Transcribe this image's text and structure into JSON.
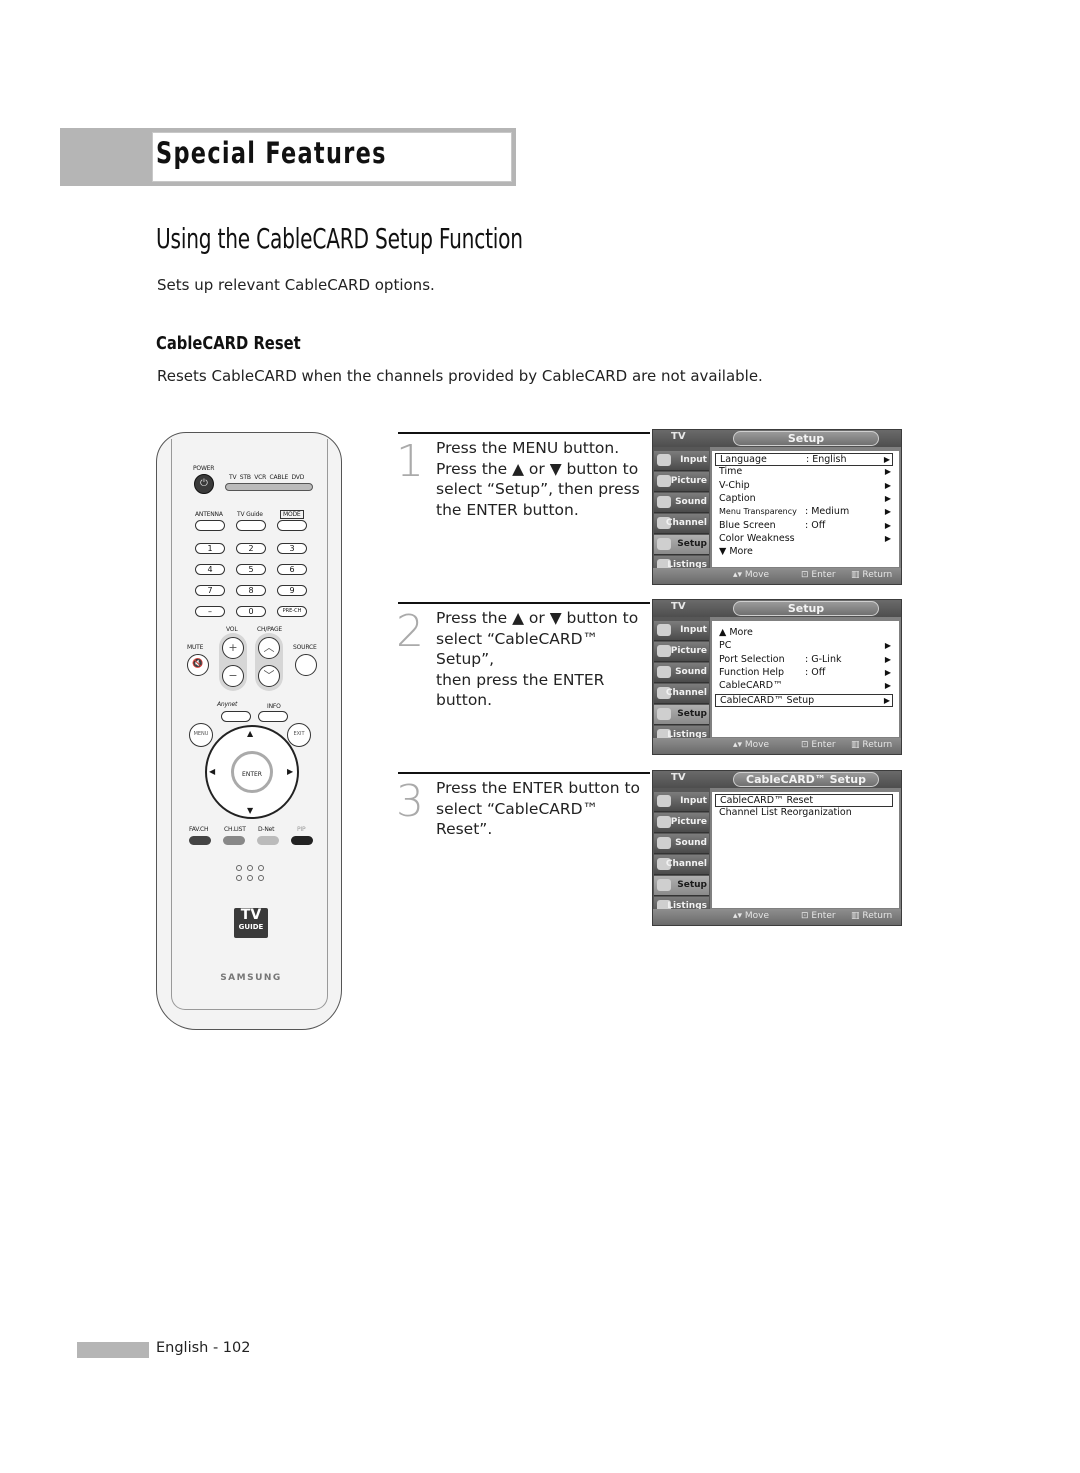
{
  "header": {
    "section": "Special Features"
  },
  "page": {
    "title": "Using the CableCARD Setup Function",
    "intro": "Sets up relevant CableCARD options.",
    "subsection_title": "CableCARD Reset",
    "subsection_desc": "Resets CableCARD when the channels provided by CableCARD are not available."
  },
  "steps": [
    {
      "number": "1",
      "lines": [
        "Press the MENU button.",
        "Press the ▲ or ▼ button to",
        "select “Setup”, then press",
        "the ENTER button."
      ]
    },
    {
      "number": "2",
      "lines": [
        "Press the ▲ or ▼ button to",
        "select “CableCARD™ Setup”,",
        "then press the ENTER button."
      ]
    },
    {
      "number": "3",
      "lines": [
        "Press the ENTER button to",
        "select “CableCARD™ Reset”."
      ]
    }
  ],
  "osd_common": {
    "tv_label": "TV",
    "sidebar": [
      "Input",
      "Picture",
      "Sound",
      "Channel",
      "Setup",
      "Listings"
    ],
    "active_sidebar": "Setup",
    "footer": {
      "move": "▴▾ Move",
      "enter": "Enter",
      "return": "Return"
    }
  },
  "osd_screens": [
    {
      "tab": "Setup",
      "rows": [
        {
          "key": "Language",
          "value": ": English",
          "arrow": "▶",
          "selected": true
        },
        {
          "key": "Time",
          "value": "",
          "arrow": "▶"
        },
        {
          "key": "V-Chip",
          "value": "",
          "arrow": "▶"
        },
        {
          "key": "Caption",
          "value": "",
          "arrow": "▶"
        },
        {
          "key": "Menu Transparency",
          "value": ": Medium",
          "arrow": "▶",
          "small": true
        },
        {
          "key": "Blue Screen",
          "value": ": Off",
          "arrow": "▶"
        },
        {
          "key": "Color Weakness",
          "value": "",
          "arrow": "▶"
        },
        {
          "key": "▼ More",
          "value": "",
          "arrow": ""
        }
      ]
    },
    {
      "tab": "Setup",
      "rows": [
        {
          "key": "▲ More",
          "value": "",
          "arrow": ""
        },
        {
          "key": "PC",
          "value": "",
          "arrow": "▶"
        },
        {
          "key": "Port Selection",
          "value": ": G-Link",
          "arrow": "▶"
        },
        {
          "key": "Function Help",
          "value": ": Off",
          "arrow": "▶"
        },
        {
          "key": "CableCARD™",
          "value": "",
          "arrow": "▶"
        },
        {
          "key": "CableCARD™ Setup",
          "value": "",
          "arrow": "▶",
          "selected": true
        }
      ]
    },
    {
      "tab": "CableCARD™ Setup",
      "rows": [
        {
          "key": "CableCARD™ Reset",
          "value": "",
          "arrow": "",
          "selected": true
        },
        {
          "key": "Channel List Reorganization",
          "value": "",
          "arrow": ""
        }
      ]
    }
  ],
  "remote": {
    "power": "POWER",
    "modes": [
      "TV",
      "STB",
      "VCR",
      "CABLE",
      "DVD"
    ],
    "top_labels": [
      "ANTENNA",
      "TV Guide",
      "MODE"
    ],
    "keys": [
      "1",
      "2",
      "3",
      "4",
      "5",
      "6",
      "7",
      "8",
      "9",
      "–",
      "0",
      "PRE-CH"
    ],
    "vol": "VOL",
    "chpage": "CH/PAGE",
    "mute": "MUTE",
    "source": "SOURCE",
    "anynet": "Anynet",
    "info": "INFO",
    "menu": "MENU",
    "exit": "EXIT",
    "enter": "ENTER",
    "color_labels": [
      "FAV.CH",
      "CH.LIST",
      "D-Net",
      "PIP"
    ],
    "tvguide_top": "TV",
    "tvguide_bottom": "GUIDE",
    "brand": "SAMSUNG"
  },
  "footer": {
    "page_label": "English - 102"
  }
}
